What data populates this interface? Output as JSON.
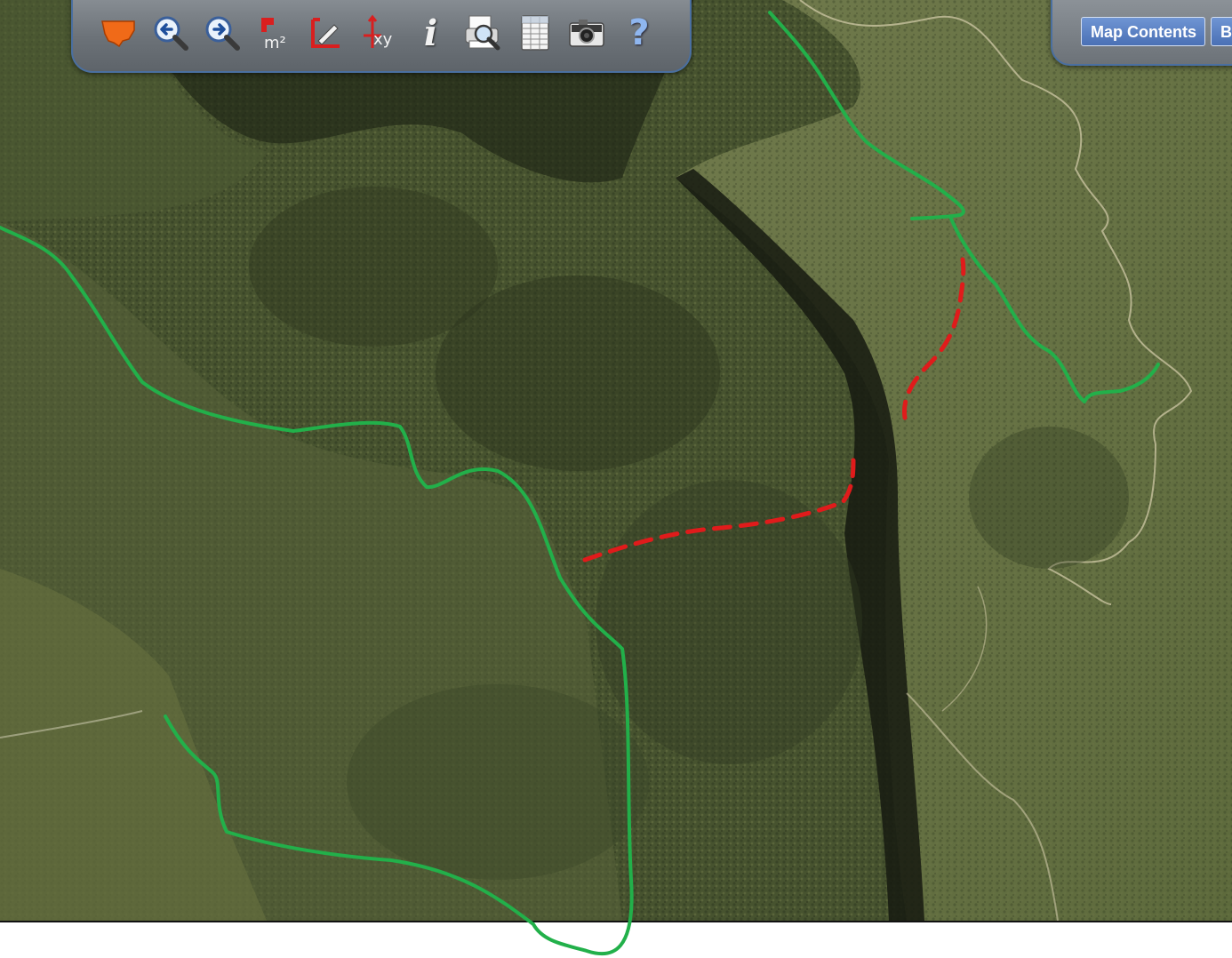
{
  "toolbar": {
    "tools": [
      {
        "name": "nsw-map-icon",
        "tooltip": ""
      },
      {
        "name": "zoom-back-icon",
        "tooltip": ""
      },
      {
        "name": "zoom-forward-icon",
        "tooltip": ""
      },
      {
        "name": "measure-area-icon",
        "label": "m²"
      },
      {
        "name": "measure-distance-icon",
        "label": ""
      },
      {
        "name": "coordinates-icon",
        "label": "xy"
      },
      {
        "name": "info-icon",
        "label": "i"
      },
      {
        "name": "print-preview-icon",
        "label": ""
      },
      {
        "name": "table-icon",
        "label": ""
      },
      {
        "name": "camera-icon",
        "label": ""
      },
      {
        "name": "help-icon",
        "label": "?"
      }
    ]
  },
  "panel": {
    "map_contents_label": "Map Contents",
    "second_label": "B"
  },
  "colors": {
    "toolbar_border": "#4a6fa0",
    "button_blue": "#5a80c4",
    "track_green": "#22b04a",
    "track_red_dashed": "#e01b1b"
  }
}
